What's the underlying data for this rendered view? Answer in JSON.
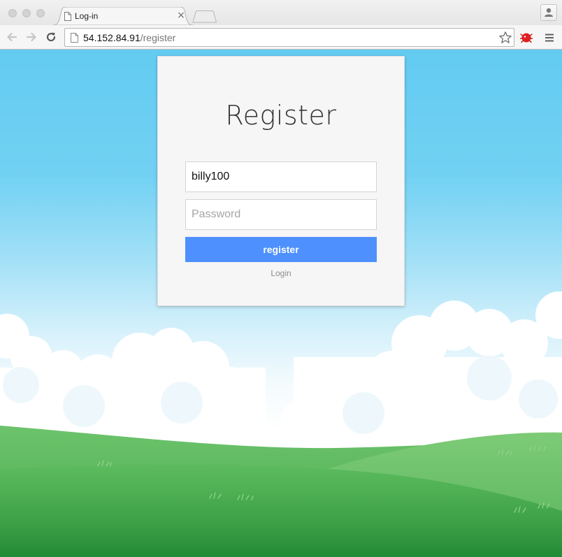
{
  "browser": {
    "tab": {
      "title": "Log-in",
      "close_glyph": "×",
      "icon": "page-icon"
    },
    "address_bar": {
      "host": "54.152.84.91",
      "path": "/register"
    },
    "icons": {
      "back": "back-arrow-icon",
      "forward": "forward-arrow-icon",
      "reload": "reload-icon",
      "bookmark": "star-icon",
      "extension": "extension-icon",
      "menu": "hamburger-menu-icon",
      "profile": "profile-icon"
    }
  },
  "page": {
    "title": "Register",
    "username": {
      "value": "billy100"
    },
    "password": {
      "placeholder": "Password"
    },
    "register_label": "register",
    "login_label": "Login"
  },
  "colors": {
    "sky": "#63cbf1",
    "button": "#4d90fe",
    "grass": "#4fb35a",
    "card": "#f6f6f6"
  }
}
